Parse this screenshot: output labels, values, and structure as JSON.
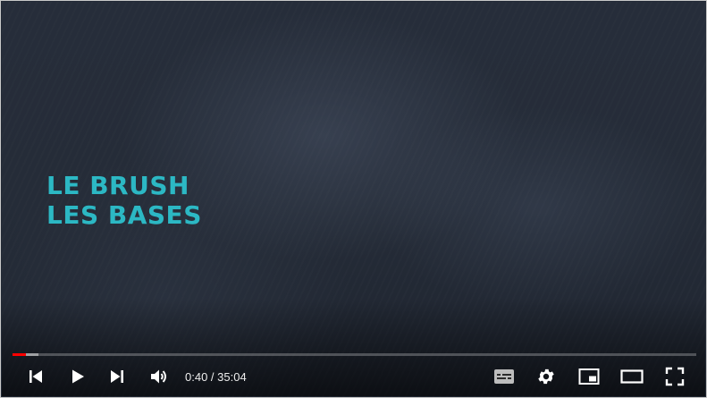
{
  "video": {
    "title_lines": [
      "LE BRUSH",
      "LES BASES"
    ],
    "accent_color": "#2cb8c4"
  },
  "progress": {
    "played_fraction": 0.019,
    "buffered_fraction": 0.038,
    "played_color": "#ff0000"
  },
  "time": {
    "current": "0:40",
    "separator": " / ",
    "duration": "35:04"
  },
  "controls": {
    "left": [
      "previous-icon",
      "play-icon",
      "next-icon",
      "volume-icon"
    ],
    "right": [
      "subtitles-icon",
      "settings-gear-icon",
      "miniplayer-icon",
      "theater-mode-icon",
      "fullscreen-icon"
    ]
  }
}
